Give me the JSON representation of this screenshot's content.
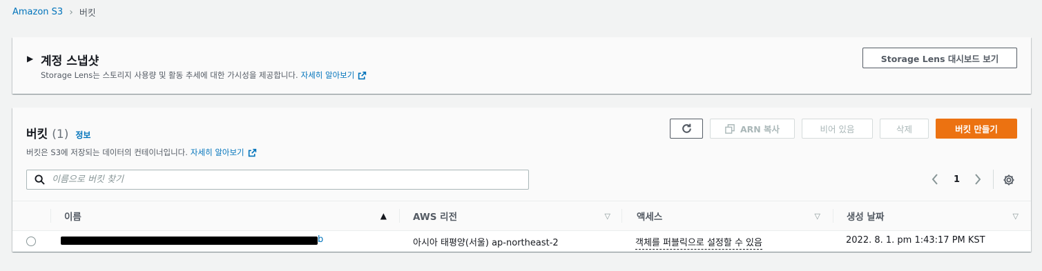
{
  "breadcrumb": {
    "root": "Amazon S3",
    "current": "버킷"
  },
  "snapshot": {
    "title": "계정 스냅샷",
    "description": "Storage Lens는 스토리지 사용량 및 활동 추세에 대한 가시성을 제공합니다.",
    "learn_more": "자세히 알아보기",
    "dashboard_button": "Storage Lens 대시보드 보기"
  },
  "buckets": {
    "title": "버킷",
    "count": "(1)",
    "info": "정보",
    "description": "버킷은 S3에 저장되는 데이터의 컨테이너입니다.",
    "learn_more": "자세히 알아보기",
    "buttons": {
      "copy_arn": "ARN 복사",
      "empty": "비어 있음",
      "delete": "삭제",
      "create": "버킷 만들기"
    },
    "search_placeholder": "이름으로 버킷 찾기",
    "page": "1",
    "columns": {
      "name": "이름",
      "region": "AWS 리전",
      "access": "액세스",
      "created": "생성 날짜"
    },
    "rows": [
      {
        "name_tail": "b",
        "region": "아시아 태평양(서울) ap-northeast-2",
        "access": "객체를 퍼블릭으로 설정할 수 있음",
        "created": "2022. 8. 1. pm 1:43:17 PM KST"
      }
    ]
  },
  "colors": {
    "primary": "#ec7211",
    "link": "#0073bb",
    "background": "#f2f3f3"
  }
}
